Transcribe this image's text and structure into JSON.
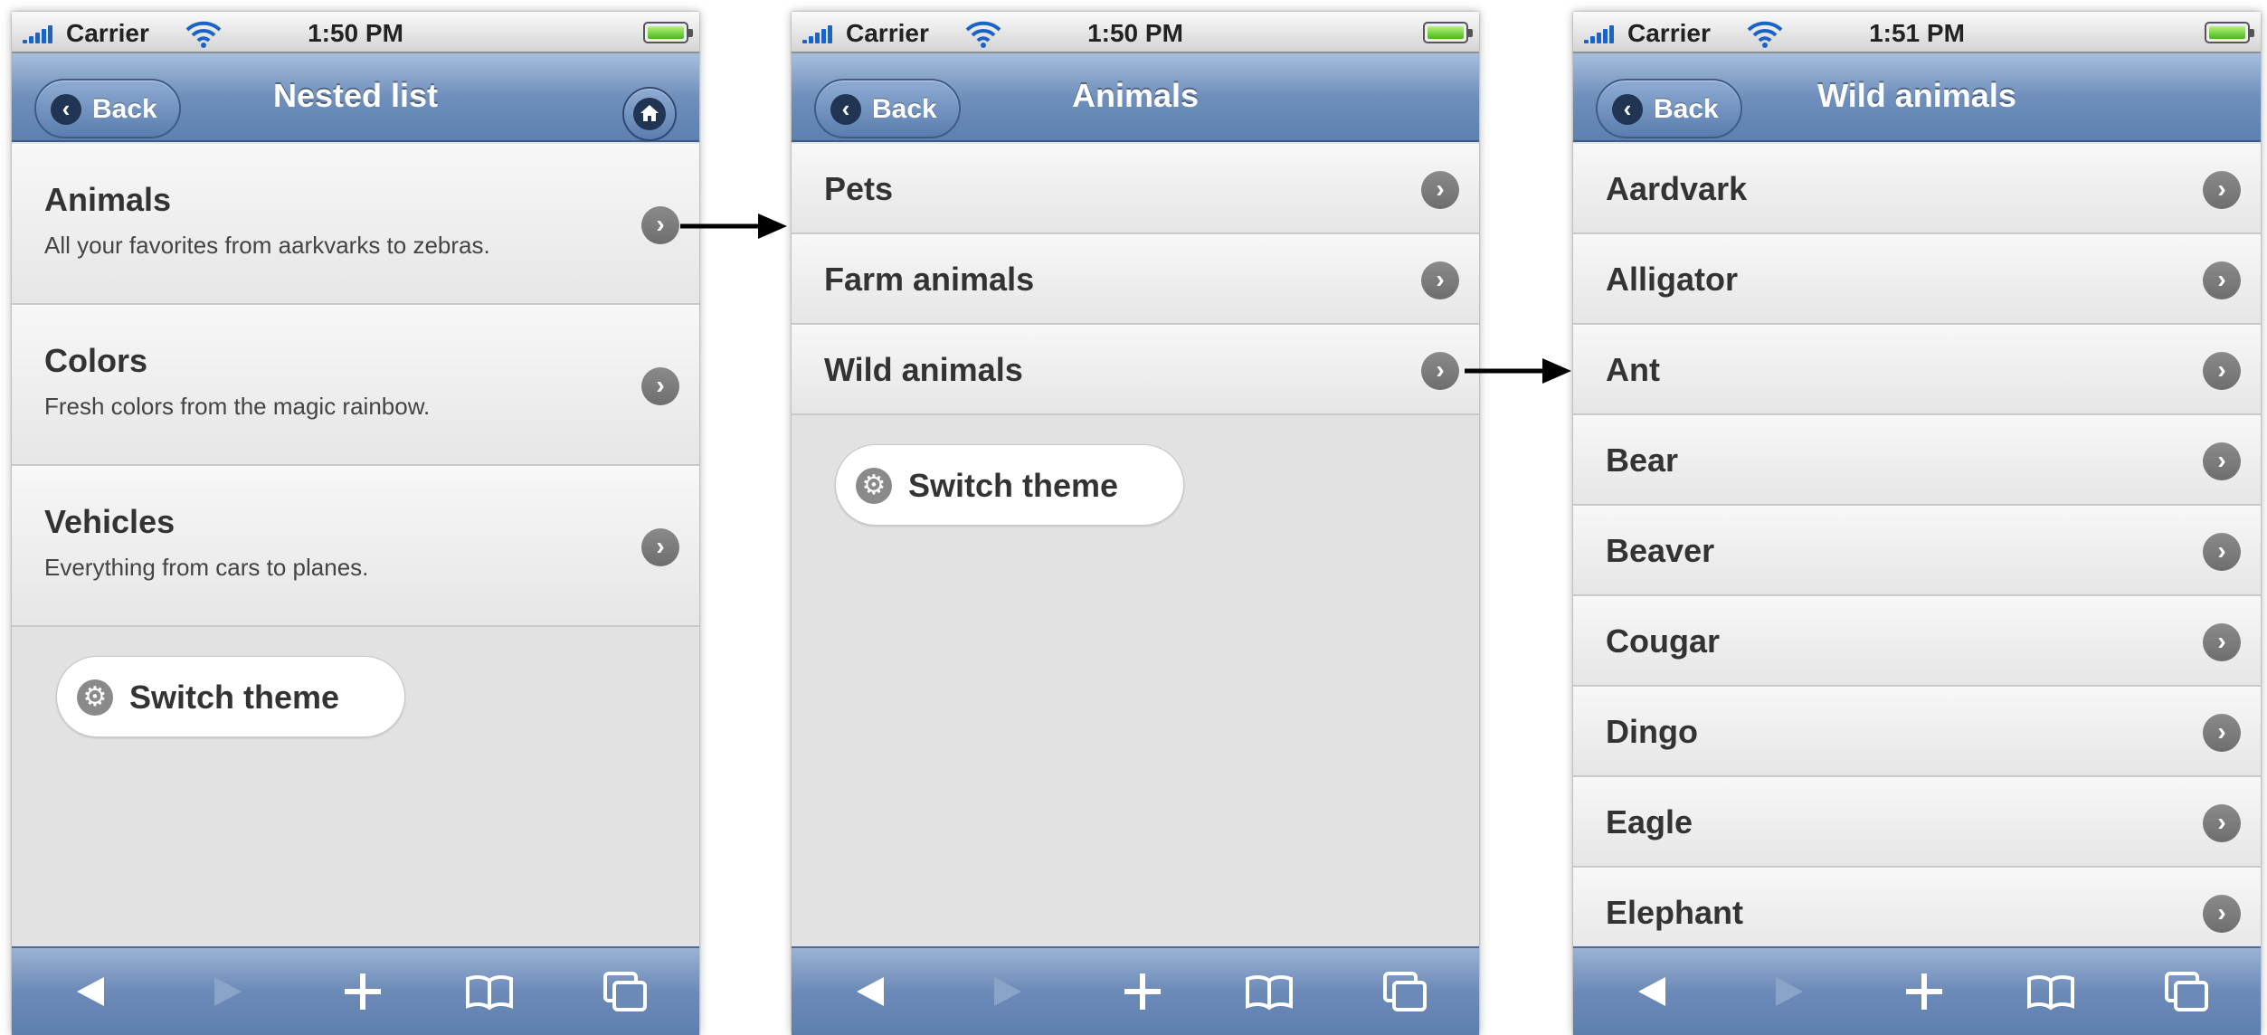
{
  "status_bar": {
    "carrier": "Carrier"
  },
  "screens": [
    {
      "time": "1:50 PM",
      "back_label": "Back",
      "title": "Nested list",
      "items": [
        {
          "title": "Animals",
          "description": "All your favorites from aarkvarks to zebras."
        },
        {
          "title": "Colors",
          "description": "Fresh colors from the magic rainbow."
        },
        {
          "title": "Vehicles",
          "description": "Everything from cars to planes."
        }
      ],
      "switch_theme": "Switch theme"
    },
    {
      "time": "1:50 PM",
      "back_label": "Back",
      "title": "Animals",
      "items": [
        {
          "title": "Pets"
        },
        {
          "title": "Farm animals"
        },
        {
          "title": "Wild animals"
        }
      ],
      "switch_theme": "Switch theme"
    },
    {
      "time": "1:51 PM",
      "back_label": "Back",
      "title": "Wild animals",
      "items": [
        {
          "title": "Aardvark"
        },
        {
          "title": "Alligator"
        },
        {
          "title": "Ant"
        },
        {
          "title": "Bear"
        },
        {
          "title": "Beaver"
        },
        {
          "title": "Cougar"
        },
        {
          "title": "Dingo"
        },
        {
          "title": "Eagle"
        },
        {
          "title": "Elephant"
        }
      ]
    }
  ],
  "icons": {
    "back": "chevron-left-icon",
    "home": "home-icon",
    "row": "chevron-right-icon",
    "switch_theme": "gear-icon",
    "toolbar": [
      "back-arrow-icon",
      "forward-arrow-icon",
      "plus-icon",
      "bookmarks-icon",
      "pages-icon"
    ]
  },
  "colors": {
    "nav_bar": "#6f8fbb",
    "toolbar": "#6c8ab8",
    "list_background": "#e2e2e2",
    "signal": "#1a63c9",
    "battery": "#46b81e"
  }
}
